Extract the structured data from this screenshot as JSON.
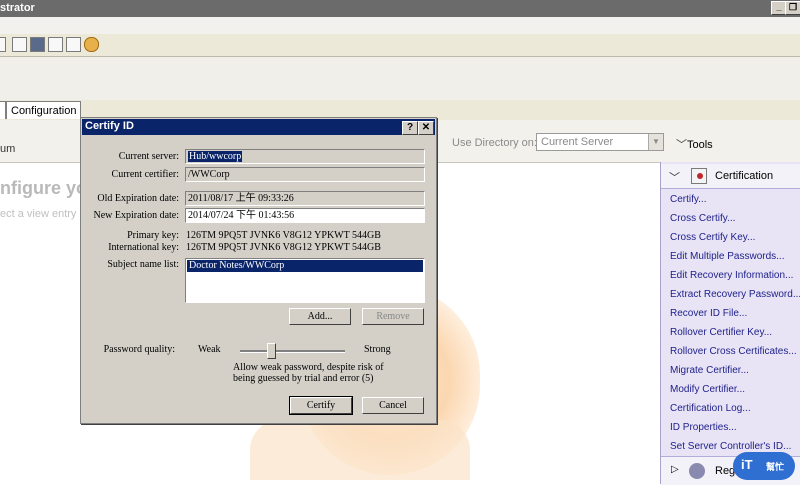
{
  "window": {
    "title_fragment": "strator"
  },
  "tabs": {
    "configuration": "Configuration"
  },
  "left": {
    "partial_label": "um",
    "heading_fragment": "nfigure yo",
    "subtext_fragment": "ect a view entry o"
  },
  "directory": {
    "label": "Use Directory on:",
    "value": "Current Server"
  },
  "tools": {
    "label": "Tools"
  },
  "tasks_panel": {
    "header": "Certification",
    "items": [
      "Certify...",
      "Cross Certify...",
      "Cross Certify Key...",
      "Edit Multiple Passwords...",
      "Edit Recovery Information...",
      "Extract Recovery Password...",
      "Recover ID File...",
      "Rollover Certifier Key...",
      "Rollover Cross Certificates...",
      "Migrate Certifier...",
      "Modify Certifier...",
      "Certification Log...",
      "ID Properties...",
      "Set Server Controller's ID..."
    ],
    "footer_label": "Reg"
  },
  "badge": {
    "text": "iT",
    "sub": "幫忙"
  },
  "dialog": {
    "title": "Certify ID",
    "help_button": "?",
    "close_button": "✕",
    "current_server_label": "Current server:",
    "current_server_value": "Hub/wwcorp",
    "current_certifier_label": "Current certifier:",
    "current_certifier_value": "/WWCorp",
    "old_expiration_label": "Old Expiration date:",
    "old_expiration_value": "2011/08/17 上午 09:33:26",
    "new_expiration_label": "New Expiration date:",
    "new_expiration_value": "2014/07/24 下午 01:43:56",
    "primary_key_label": "Primary key:",
    "primary_key_value": "126TM 9PQ5T JVNK6 V8G12 YPKWT 544GB",
    "international_key_label": "International key:",
    "international_key_value": "126TM 9PQ5T JVNK6 V8G12 YPKWT 544GB",
    "subject_name_label": "Subject name list:",
    "subject_names": [
      "Doctor Notes/WWCorp"
    ],
    "add_button": "Add...",
    "remove_button": "Remove",
    "password_quality_label": "Password quality:",
    "weak_label": "Weak",
    "strong_label": "Strong",
    "password_quality_level": 0.3,
    "quality_desc_line1": "Allow weak password, despite risk of",
    "quality_desc_line2": "being guessed by trial and error (5)",
    "certify_button": "Certify",
    "cancel_button": "Cancel"
  }
}
